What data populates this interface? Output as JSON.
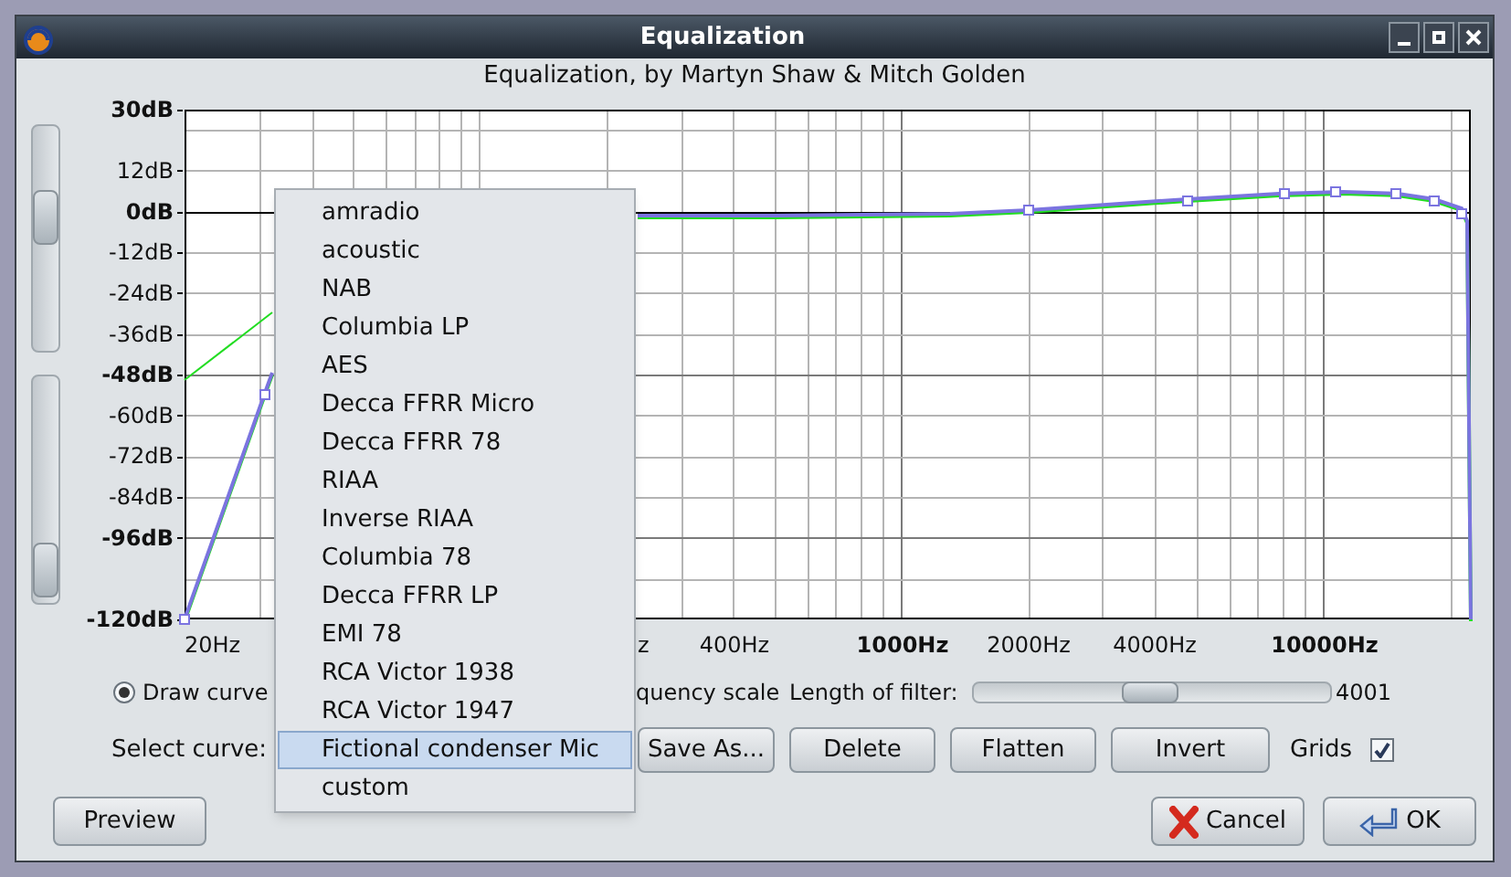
{
  "window": {
    "title": "Equalization"
  },
  "subtitle": "Equalization, by Martyn Shaw & Mitch Golden",
  "range_sliders": [
    {
      "level": 0.38
    },
    {
      "level": 0.97
    }
  ],
  "graph": {
    "x_labels": [
      {
        "label": "20Hz",
        "bold": false
      },
      {
        "label": "z",
        "bold": false
      },
      {
        "label": "400Hz",
        "bold": false
      },
      {
        "label": "1000Hz",
        "bold": true
      },
      {
        "label": "2000Hz",
        "bold": false
      },
      {
        "label": "4000Hz",
        "bold": false
      },
      {
        "label": "10000Hz",
        "bold": true
      }
    ],
    "y_labels": [
      {
        "label": "30dB",
        "bold": true
      },
      {
        "label": "12dB",
        "bold": false
      },
      {
        "label": "0dB",
        "bold": true
      },
      {
        "label": "-12dB",
        "bold": false
      },
      {
        "label": "-24dB",
        "bold": false
      },
      {
        "label": "-36dB",
        "bold": false
      },
      {
        "label": "-48dB",
        "bold": true
      },
      {
        "label": "-60dB",
        "bold": false
      },
      {
        "label": "-72dB",
        "bold": false
      },
      {
        "label": "-84dB",
        "bold": false
      },
      {
        "label": "-96dB",
        "bold": true
      },
      {
        "label": "-120dB",
        "bold": true
      }
    ]
  },
  "draw_mode": {
    "label": "Draw curve",
    "selected": true
  },
  "frequency_scale_label": "quency scale",
  "filter_length": {
    "label": "Length of filter:",
    "level": 0.49,
    "reading": "4001"
  },
  "select_curve": {
    "label": "Select curve:"
  },
  "buttons": [
    {
      "label": "Save As..."
    },
    {
      "label": "Delete"
    },
    {
      "label": "Flatten"
    },
    {
      "label": "Invert"
    }
  ],
  "grids": {
    "label": "Grids",
    "checked": true
  },
  "preview_button": {
    "label": "Preview"
  },
  "cancel_button": {
    "label": "Cancel"
  },
  "ok_button": {
    "label": "OK"
  },
  "curve_menu": {
    "items": [
      {
        "label": "amradio",
        "selected": false
      },
      {
        "label": "acoustic",
        "selected": false
      },
      {
        "label": "NAB",
        "selected": false
      },
      {
        "label": "Columbia LP",
        "selected": false
      },
      {
        "label": "AES",
        "selected": false
      },
      {
        "label": "Decca FFRR Micro",
        "selected": false
      },
      {
        "label": "Decca FFRR 78",
        "selected": false
      },
      {
        "label": "RIAA",
        "selected": false
      },
      {
        "label": "Inverse RIAA",
        "selected": false
      },
      {
        "label": "Columbia 78",
        "selected": false
      },
      {
        "label": "Decca FFRR LP",
        "selected": false
      },
      {
        "label": "EMI 78",
        "selected": false
      },
      {
        "label": "RCA Victor 1938",
        "selected": false
      },
      {
        "label": "RCA Victor 1947",
        "selected": false
      },
      {
        "label": "Fictional condenser Mic",
        "selected": true
      },
      {
        "label": "custom",
        "selected": false
      }
    ]
  }
}
